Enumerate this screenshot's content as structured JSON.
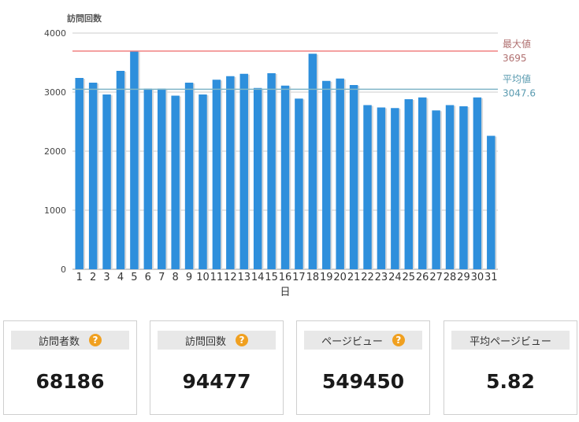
{
  "chart_data": {
    "type": "bar",
    "ylabel": "訪問回数",
    "xlabel": "日",
    "ylim": [
      0,
      4000
    ],
    "yticks": [
      0,
      1000,
      2000,
      3000,
      4000
    ],
    "categories": [
      "1",
      "2",
      "3",
      "4",
      "5",
      "6",
      "7",
      "8",
      "9",
      "10",
      "11",
      "12",
      "13",
      "14",
      "15",
      "16",
      "17",
      "18",
      "19",
      "20",
      "21",
      "22",
      "23",
      "24",
      "25",
      "26",
      "27",
      "28",
      "29",
      "30",
      "31"
    ],
    "values": [
      3240,
      3160,
      2960,
      3360,
      3695,
      3060,
      3060,
      2940,
      3160,
      2960,
      3210,
      3270,
      3310,
      3070,
      3320,
      3110,
      2890,
      3650,
      3190,
      3230,
      3120,
      2780,
      2740,
      2730,
      2880,
      2910,
      2690,
      2780,
      2760,
      2910,
      2260
    ],
    "bar_color": "#2e8fdc",
    "reference_lines": [
      {
        "label": "最大値",
        "value": 3695,
        "value_text": "3695",
        "color": "#f08080",
        "text_color": "#b07070"
      },
      {
        "label": "平均値",
        "value": 3047.6,
        "value_text": "3047.6",
        "color": "#7fb5c7",
        "text_color": "#5a9bb0"
      }
    ]
  },
  "stats": [
    {
      "label": "訪問者数",
      "value": "68186",
      "help": "?"
    },
    {
      "label": "訪問回数",
      "value": "94477",
      "help": "?"
    },
    {
      "label": "ページビュー",
      "value": "549450",
      "help": "?"
    },
    {
      "label": "平均ページビュー",
      "value": "5.82"
    }
  ]
}
